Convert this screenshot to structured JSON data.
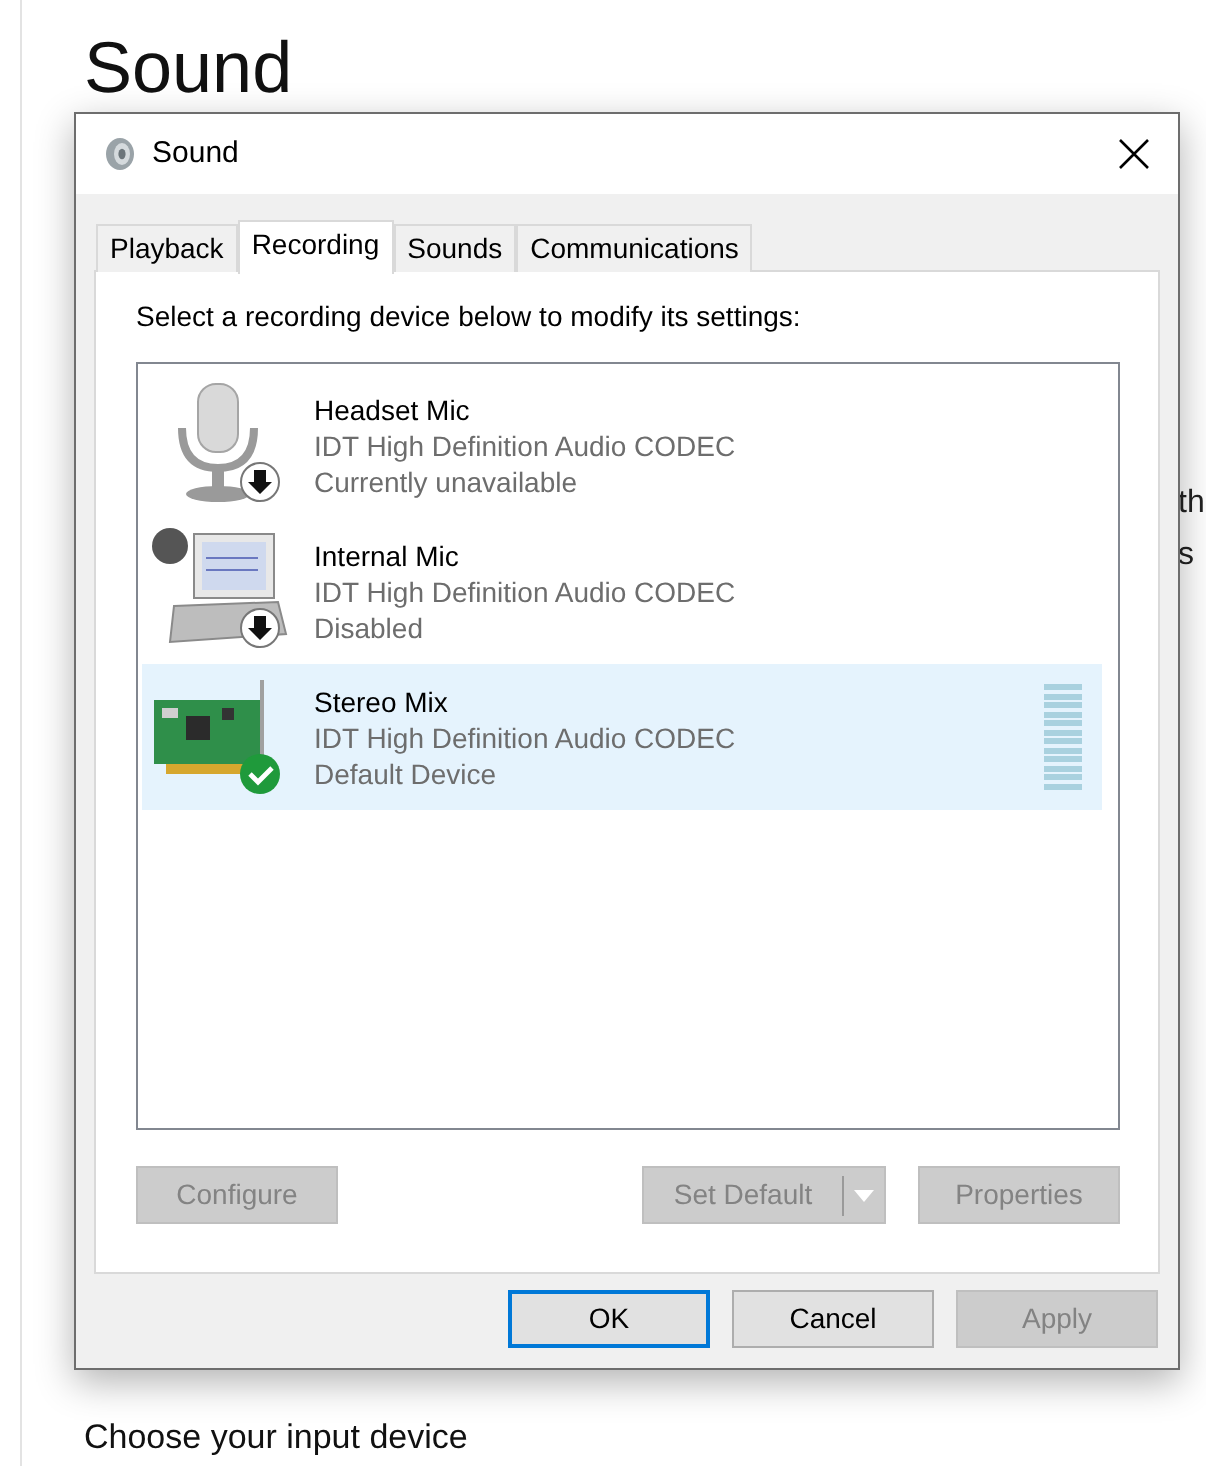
{
  "page": {
    "title": "Sound",
    "cut_lines": [
      "th",
      "s"
    ],
    "section": "Choose your input device"
  },
  "window": {
    "title": "Sound"
  },
  "tabs": [
    {
      "label": "Playback",
      "selected": false
    },
    {
      "label": "Recording",
      "selected": true
    },
    {
      "label": "Sounds",
      "selected": false
    },
    {
      "label": "Communications",
      "selected": false
    }
  ],
  "instruction": "Select a recording device below to modify its settings:",
  "devices": [
    {
      "name": "Headset Mic",
      "driver": "IDT High Definition Audio CODEC",
      "status": "Currently unavailable",
      "icon": {
        "kind": "microphone"
      },
      "badge": {
        "kind": "down"
      },
      "selected": false
    },
    {
      "name": "Internal Mic",
      "driver": "IDT High Definition Audio CODEC",
      "status": "Disabled",
      "icon": {
        "kind": "laptop"
      },
      "badge": {
        "kind": "down"
      },
      "selected": false
    },
    {
      "name": "Stereo Mix",
      "driver": "IDT High Definition Audio CODEC",
      "status": "Default Device",
      "icon": {
        "kind": "card"
      },
      "badge": {
        "kind": "check"
      },
      "selected": true
    }
  ],
  "panel_buttons": [
    {
      "label": "Configure",
      "disabled": true,
      "kind": "plain"
    },
    {
      "label": "Set Default",
      "disabled": true,
      "kind": "split"
    },
    {
      "label": "Properties",
      "disabled": true,
      "kind": "plain"
    }
  ],
  "buttons": [
    {
      "label": "OK",
      "disabled": false,
      "default": true
    },
    {
      "label": "Cancel",
      "disabled": false,
      "default": false
    },
    {
      "label": "Apply",
      "disabled": true,
      "default": false
    }
  ]
}
